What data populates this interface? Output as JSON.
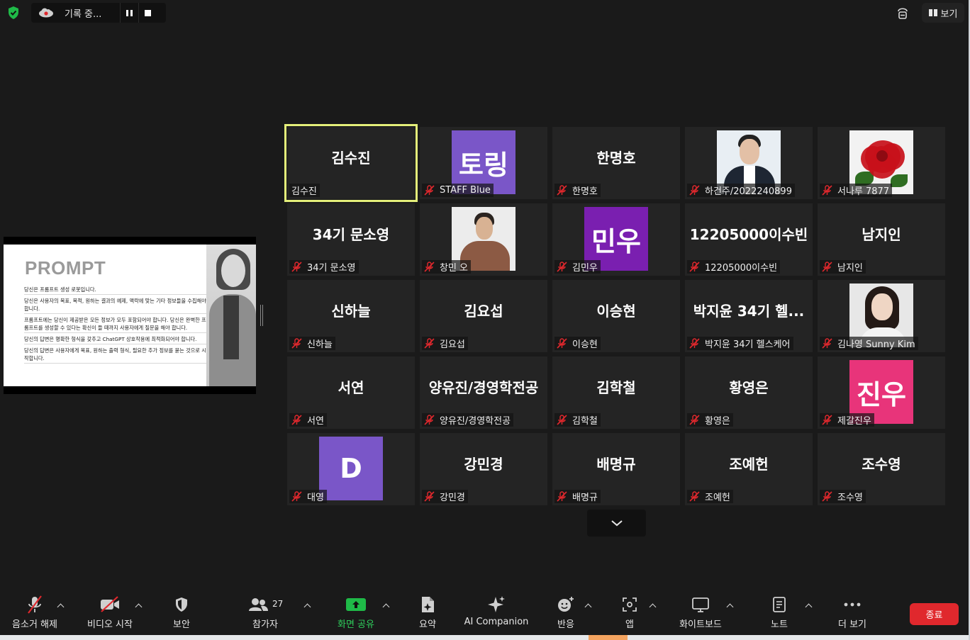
{
  "top_bar": {
    "recording_label": "기록 중...",
    "view_label": "보기"
  },
  "shared_screen": {
    "title": "PROMPT",
    "lines": [
      "당신은 프롬프트 생성 로봇입니다.",
      "당신은 사용자의 목표, 목적, 원하는 결과의 예제, 맥락에 맞는 기타 정보들을 수집해야 합니다.",
      "프롬프트에는 당신이 제공받은 모든 정보가 모두 포함되어야 합니다. 당신은 완벽한 프롬프트를 생성할 수 있다는 확신이 들 때까지 사용자에게 질문을 해야 합니다.",
      "당신의 답변은 명확한 형식을 갖추고 ChatGPT 상호작용에 최적화되어야 합니다.",
      "당신의 답변은 사용자에게 목표, 원하는 출력 형식, 필요한 추가 정보를 묻는 것으로 시작합니다."
    ]
  },
  "participants": [
    {
      "display": "김수진",
      "name": "김수진",
      "kind": "text",
      "muted": false,
      "active": true
    },
    {
      "display": "토링",
      "name": "STAFF Blue",
      "kind": "avatar",
      "color": "#7a56c8",
      "muted": true
    },
    {
      "display": "한명호",
      "name": "한명호",
      "kind": "text",
      "muted": true
    },
    {
      "display": "",
      "name": "하건주/2022240899",
      "kind": "photo",
      "photo": "suit",
      "muted": true
    },
    {
      "display": "",
      "name": "서나루 7877",
      "kind": "photo",
      "photo": "rose",
      "muted": true
    },
    {
      "display": "34기 문소영",
      "name": "34기 문소영",
      "kind": "text",
      "muted": true
    },
    {
      "display": "",
      "name": "창민 오",
      "kind": "photo",
      "photo": "man",
      "muted": true
    },
    {
      "display": "민우",
      "name": "김민우",
      "kind": "avatar",
      "color": "#7a1fb0",
      "muted": true
    },
    {
      "display": "12205000이수빈",
      "name": "12205000이수빈",
      "kind": "text",
      "muted": true
    },
    {
      "display": "남지인",
      "name": "남지인",
      "kind": "text",
      "muted": true
    },
    {
      "display": "신하늘",
      "name": "신하늘",
      "kind": "text",
      "muted": true
    },
    {
      "display": "김요섭",
      "name": "김요섭",
      "kind": "text",
      "muted": true
    },
    {
      "display": "이승현",
      "name": "이승현",
      "kind": "text",
      "muted": true
    },
    {
      "display": "박지윤 34기 헬...",
      "name": "박지윤 34기 헬스케어",
      "kind": "text",
      "muted": true
    },
    {
      "display": "",
      "name": "김나영 Sunny Kim",
      "kind": "photo",
      "photo": "girl",
      "muted": true
    },
    {
      "display": "서연",
      "name": "서연",
      "kind": "text",
      "muted": true
    },
    {
      "display": "양유진/경영학전공",
      "name": "양유진/경영학전공",
      "kind": "text",
      "muted": true
    },
    {
      "display": "김학철",
      "name": "김학철",
      "kind": "text",
      "muted": true
    },
    {
      "display": "황영은",
      "name": "황영은",
      "kind": "text",
      "muted": true
    },
    {
      "display": "진우",
      "name": "제갈진우",
      "kind": "avatar",
      "color": "#e8347a",
      "muted": true
    },
    {
      "display": "D",
      "name": "대영",
      "kind": "avatar",
      "color": "#7a56c8",
      "muted": true
    },
    {
      "display": "강민경",
      "name": "강민경",
      "kind": "text",
      "muted": true
    },
    {
      "display": "배명규",
      "name": "배명규",
      "kind": "text",
      "muted": true
    },
    {
      "display": "조예헌",
      "name": "조예헌",
      "kind": "text",
      "muted": true
    },
    {
      "display": "조수영",
      "name": "조수영",
      "kind": "text",
      "muted": true
    }
  ],
  "toolbar": {
    "unmute": "음소거 해제",
    "start_video": "비디오 시작",
    "security": "보안",
    "participants": "참가자",
    "participants_count": "27",
    "share_screen": "화면 공유",
    "summary": "요약",
    "ai_companion": "AI Companion",
    "reactions": "반응",
    "apps": "앱",
    "whiteboard": "화이트보드",
    "notes": "노트",
    "more": "더 보기",
    "end": "종료"
  },
  "colors": {
    "background": "#1a1a1a",
    "tile": "#242424",
    "active_border": "#e4ef7a",
    "share_green": "#1fba48",
    "end_red": "#e0282d",
    "muted_red": "#e0282d"
  }
}
